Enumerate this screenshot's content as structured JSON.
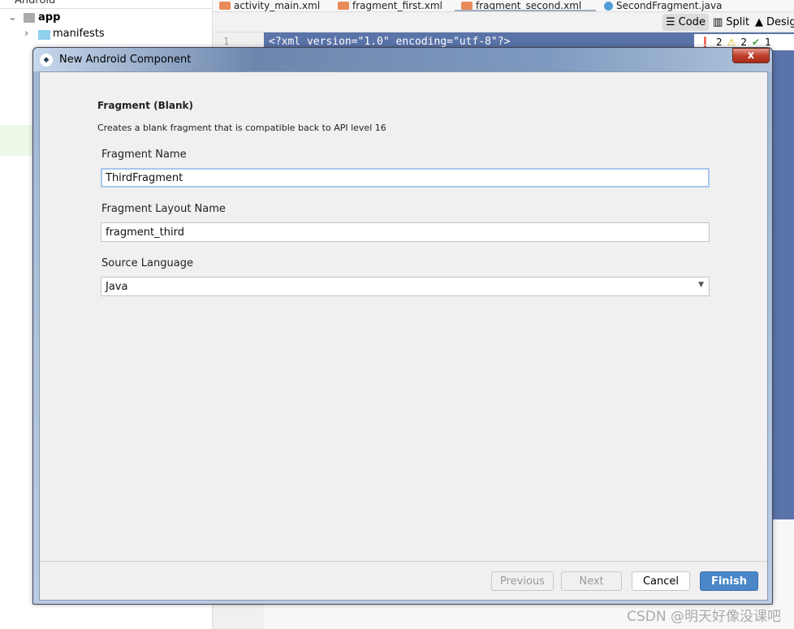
{
  "project_panel": {
    "view": "Android",
    "root": "app",
    "items": [
      "manifests"
    ]
  },
  "tabs": [
    "activity_main.xml",
    "fragment_first.xml",
    "fragment_second.xml",
    "SecondFragment.java"
  ],
  "toolbar": {
    "code": "Code",
    "split": "Split",
    "design": "Design"
  },
  "editor": {
    "line_number": "1",
    "line1": "<?xml version=\"1.0\" encoding=\"utf-8\"?>",
    "errors": "2",
    "warnings": "2",
    "ok": "1"
  },
  "dialog": {
    "title": "New Android Component",
    "close": "x",
    "heading": "Fragment (Blank)",
    "description": "Creates a blank fragment that is compatible back to API level 16",
    "fragment_name_label": "Fragment Name",
    "fragment_name": "ThirdFragment",
    "layout_name_label": "Fragment Layout Name",
    "layout_name": "fragment_third",
    "language_label": "Source Language",
    "language": "Java",
    "buttons": {
      "previous": "Previous",
      "next": "Next",
      "cancel": "Cancel",
      "finish": "Finish"
    }
  },
  "watermark": "CSDN @明天好像没课吧",
  "colors": {
    "accent": "#4a86c8",
    "selection": "#5a73a8"
  }
}
